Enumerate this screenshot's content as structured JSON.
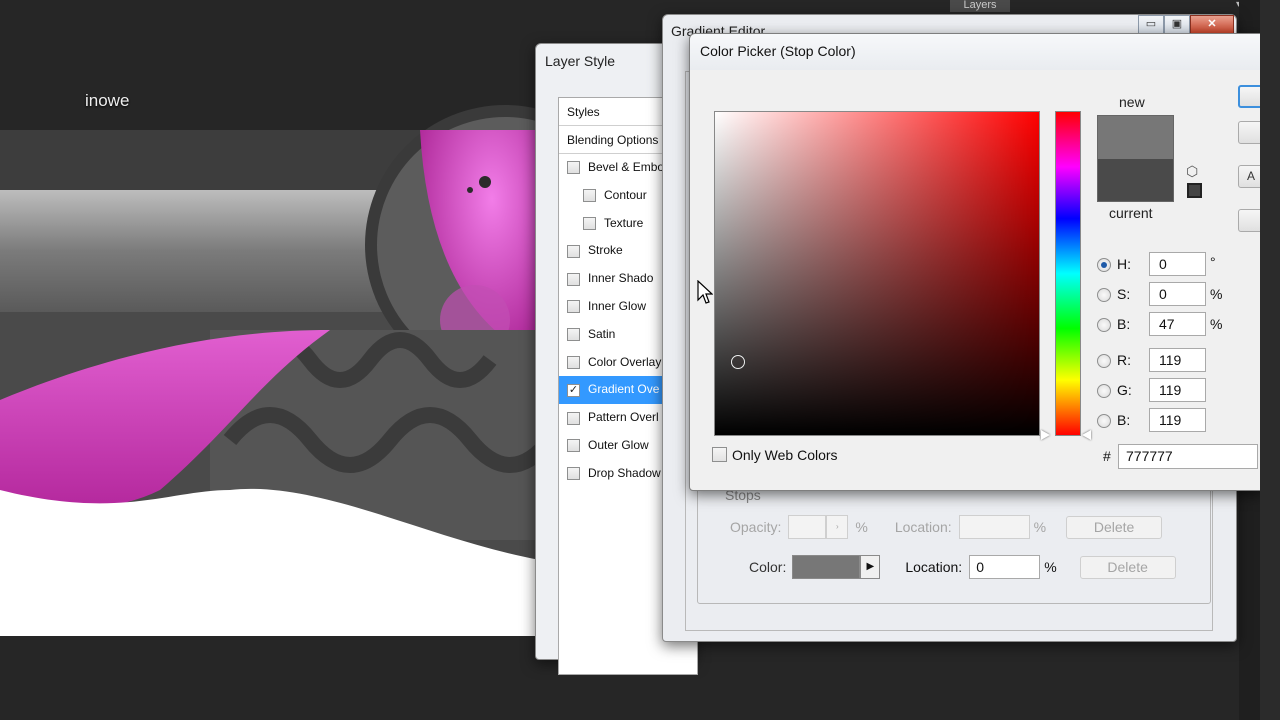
{
  "canvas": {
    "doc_label": "inowe",
    "layers_tab": "Layers"
  },
  "layer_style": {
    "title": "Layer Style",
    "styles_header": "Styles",
    "blending_options": "Blending Options",
    "items": [
      {
        "label": "Bevel & Embo",
        "checked": false,
        "sub": false
      },
      {
        "label": "Contour",
        "checked": false,
        "sub": true
      },
      {
        "label": "Texture",
        "checked": false,
        "sub": true
      },
      {
        "label": "Stroke",
        "checked": false,
        "sub": false
      },
      {
        "label": "Inner Shado",
        "checked": false,
        "sub": false
      },
      {
        "label": "Inner Glow",
        "checked": false,
        "sub": false
      },
      {
        "label": "Satin",
        "checked": false,
        "sub": false
      },
      {
        "label": "Color Overlay",
        "checked": false,
        "sub": false
      },
      {
        "label": "Gradient Ove",
        "checked": true,
        "sub": false,
        "active": true
      },
      {
        "label": "Pattern Overl",
        "checked": false,
        "sub": false
      },
      {
        "label": "Outer Glow",
        "checked": false,
        "sub": false
      },
      {
        "label": "Drop Shadow",
        "checked": false,
        "sub": false
      }
    ]
  },
  "gradient_editor": {
    "title": "Gradient Editor",
    "stops_legend": "Stops",
    "opacity_label": "Opacity:",
    "opacity_unit": "%",
    "location_label": "Location:",
    "location_unit": "%",
    "delete_label": "Delete",
    "color_label": "Color:",
    "color_location_value": "0",
    "stop_color": "#777777"
  },
  "color_picker": {
    "title": "Color Picker (Stop Color)",
    "new_label": "new",
    "current_label": "current",
    "new_color": "#777777",
    "current_color": "#4a4a4a",
    "only_web_colors": "Only Web Colors",
    "hex_prefix": "#",
    "hex_value": "777777",
    "fields": {
      "H": {
        "label": "H:",
        "value": "0",
        "unit": "°"
      },
      "S": {
        "label": "S:",
        "value": "0",
        "unit": "%"
      },
      "Bv": {
        "label": "B:",
        "value": "47",
        "unit": "%"
      },
      "R": {
        "label": "R:",
        "value": "119"
      },
      "G": {
        "label": "G:",
        "value": "119"
      },
      "Bc": {
        "label": "B:",
        "value": "119"
      }
    }
  }
}
